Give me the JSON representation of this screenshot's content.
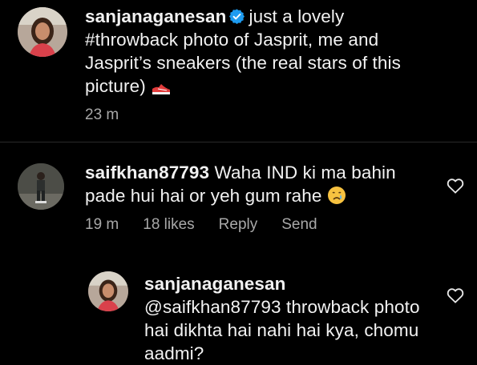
{
  "caption": {
    "username": "sanjanaganesan",
    "text": "just a lovely #throwback photo of Jasprit, me and Jasprit’s sneakers (the real stars of this picture)",
    "emoji": "sneaker-emoji",
    "time": "23 m"
  },
  "comment": {
    "username": "saifkhan87793",
    "text": "Waha IND ki ma bahin pade hui hai or yeh gum rahe",
    "emoji": "crying-face-emoji",
    "time": "19 m",
    "likes": "18 likes",
    "reply_label": "Reply",
    "send_label": "Send"
  },
  "reply": {
    "username": "sanjanaganesan",
    "text": "@saifkhan87793 throwback photo hai dikhta hai nahi hai kya, chomu aadmi?"
  },
  "colors": {
    "background": "#000000",
    "text": "#f2f2f2",
    "meta": "#a8a8a8",
    "verified": "#1d9bf0"
  }
}
